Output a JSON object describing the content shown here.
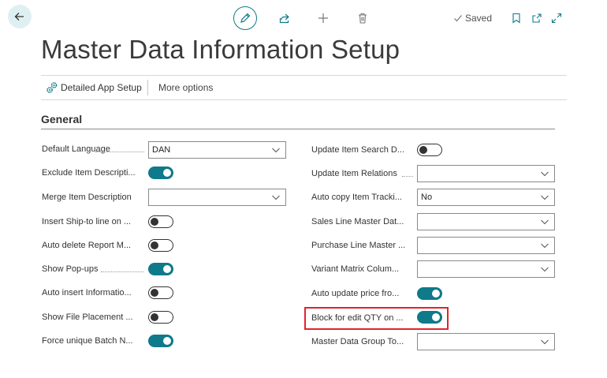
{
  "toolbar": {
    "back_icon": "arrow-left-icon",
    "edit_icon": "pencil-icon",
    "share_icon": "share-icon",
    "new_icon": "plus-icon",
    "delete_icon": "trash-icon",
    "saved_label": "Saved",
    "bookmark_icon": "bookmark-icon",
    "open_new_icon": "open-in-new-window-icon",
    "expand_icon": "expand-icon"
  },
  "page": {
    "title": "Master Data Information Setup"
  },
  "actions": {
    "detailed_app_setup": "Detailed App Setup",
    "more_options": "More options"
  },
  "section": {
    "title": "General"
  },
  "left_fields": [
    {
      "label": "Default Language",
      "type": "select",
      "value": "DAN"
    },
    {
      "label": "Exclude Item Descripti...",
      "type": "toggle",
      "value": true
    },
    {
      "label": "Merge Item Description",
      "type": "select",
      "value": ""
    },
    {
      "label": "Insert Ship-to line on ...",
      "type": "toggle",
      "value": false
    },
    {
      "label": "Auto delete Report M...",
      "type": "toggle",
      "value": false
    },
    {
      "label": "Show Pop-ups",
      "type": "toggle",
      "value": true
    },
    {
      "label": "Auto insert Informatio...",
      "type": "toggle",
      "value": false
    },
    {
      "label": "Show File Placement ...",
      "type": "toggle",
      "value": false
    },
    {
      "label": "Force unique Batch N...",
      "type": "toggle",
      "value": true
    }
  ],
  "right_fields": [
    {
      "label": "Update Item Search D...",
      "type": "toggle",
      "value": false
    },
    {
      "label": "Update Item Relations",
      "type": "select",
      "value": ""
    },
    {
      "label": "Auto copy Item Tracki...",
      "type": "select",
      "value": "No"
    },
    {
      "label": "Sales Line Master Dat...",
      "type": "select",
      "value": ""
    },
    {
      "label": "Purchase Line Master ...",
      "type": "select",
      "value": ""
    },
    {
      "label": "Variant Matrix Colum...",
      "type": "select",
      "value": ""
    },
    {
      "label": "Auto update price fro...",
      "type": "toggle",
      "value": true
    },
    {
      "label": "Block for edit QTY on ...",
      "type": "toggle",
      "value": true
    },
    {
      "label": "Master Data Group To...",
      "type": "select",
      "value": ""
    }
  ],
  "colors": {
    "accent": "#0e7a8a",
    "highlight": "#e0242b"
  }
}
